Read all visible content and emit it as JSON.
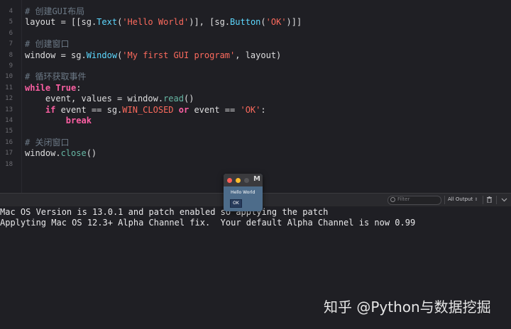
{
  "editor": {
    "lines": [
      {
        "num": "4",
        "tokens": [
          {
            "t": "# 创建GUI布局",
            "c": "cm"
          }
        ]
      },
      {
        "num": "5",
        "tokens": [
          {
            "t": "layout = [[",
            "c": "pl"
          },
          {
            "t": "sg",
            "c": "pl"
          },
          {
            "t": ".",
            "c": "pl"
          },
          {
            "t": "Text",
            "c": "ty"
          },
          {
            "t": "(",
            "c": "pl"
          },
          {
            "t": "'Hello World'",
            "c": "str"
          },
          {
            "t": ")], [",
            "c": "pl"
          },
          {
            "t": "sg",
            "c": "pl"
          },
          {
            "t": ".",
            "c": "pl"
          },
          {
            "t": "Button",
            "c": "ty"
          },
          {
            "t": "(",
            "c": "pl"
          },
          {
            "t": "'OK'",
            "c": "str"
          },
          {
            "t": ")]]",
            "c": "pl"
          }
        ]
      },
      {
        "num": "6",
        "tokens": []
      },
      {
        "num": "7",
        "tokens": [
          {
            "t": "# 创建窗口",
            "c": "cm"
          }
        ]
      },
      {
        "num": "8",
        "tokens": [
          {
            "t": "window = sg.",
            "c": "pl"
          },
          {
            "t": "Window",
            "c": "ty"
          },
          {
            "t": "(",
            "c": "pl"
          },
          {
            "t": "'My first GUI program'",
            "c": "str"
          },
          {
            "t": ", layout)",
            "c": "pl"
          }
        ]
      },
      {
        "num": "9",
        "tokens": []
      },
      {
        "num": "10",
        "tokens": [
          {
            "t": "# 循环获取事件",
            "c": "cm"
          }
        ]
      },
      {
        "num": "11",
        "tokens": [
          {
            "t": "while",
            "c": "kw"
          },
          {
            "t": " ",
            "c": "pl"
          },
          {
            "t": "True",
            "c": "kw"
          },
          {
            "t": ":",
            "c": "pl"
          }
        ]
      },
      {
        "num": "12",
        "tokens": [
          {
            "t": "    event, values = window.",
            "c": "pl"
          },
          {
            "t": "read",
            "c": "fn"
          },
          {
            "t": "()",
            "c": "pl"
          }
        ]
      },
      {
        "num": "13",
        "tokens": [
          {
            "t": "    ",
            "c": "pl"
          },
          {
            "t": "if",
            "c": "kw"
          },
          {
            "t": " event == sg.",
            "c": "pl"
          },
          {
            "t": "WIN_CLOSED",
            "c": "str"
          },
          {
            "t": " ",
            "c": "pl"
          },
          {
            "t": "or",
            "c": "kw"
          },
          {
            "t": " event == ",
            "c": "pl"
          },
          {
            "t": "'OK'",
            "c": "str"
          },
          {
            "t": ":",
            "c": "pl"
          }
        ]
      },
      {
        "num": "14",
        "tokens": [
          {
            "t": "        ",
            "c": "pl"
          },
          {
            "t": "break",
            "c": "kw"
          }
        ]
      },
      {
        "num": "15",
        "tokens": []
      },
      {
        "num": "16",
        "tokens": [
          {
            "t": "# 关闭窗口",
            "c": "cm"
          }
        ]
      },
      {
        "num": "17",
        "tokens": [
          {
            "t": "window.",
            "c": "pl"
          },
          {
            "t": "close",
            "c": "fn"
          },
          {
            "t": "()",
            "c": "pl"
          }
        ]
      },
      {
        "num": "18",
        "tokens": []
      }
    ]
  },
  "gui_window": {
    "title": "M",
    "text": "Hello World",
    "button_label": "OK"
  },
  "console_bar": {
    "filter_placeholder": "Filter",
    "output_select": "All Output"
  },
  "console": {
    "lines": [
      "Mac OS Version is 13.0.1 and patch enabled so applying the patch",
      "Applyting Mac OS 12.3+ Alpha Channel fix.  Your default Alpha Channel is now 0.99"
    ]
  },
  "watermark": "知乎 @Python与数据挖掘",
  "colors": {
    "background": "#1f1f24",
    "comment": "#6c7986",
    "keyword": "#fc5fa3",
    "string": "#fc6a5d",
    "type": "#5dd8ff",
    "function": "#67b7a4",
    "gui_window_bg": "#4d6c8a"
  }
}
